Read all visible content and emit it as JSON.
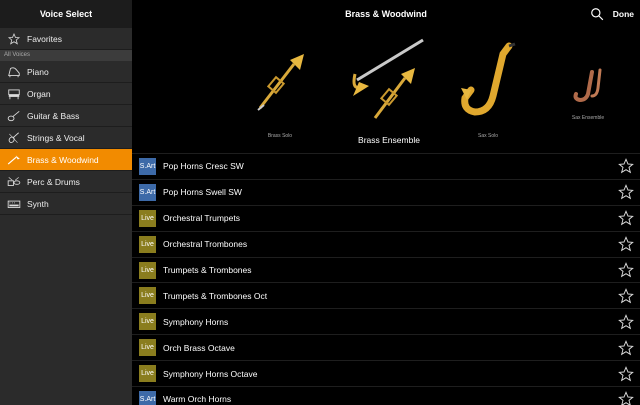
{
  "sidebar": {
    "title": "Voice Select",
    "favorites_label": "Favorites",
    "section_label": "All Voices",
    "items": [
      {
        "label": "Piano",
        "icon": "piano-icon"
      },
      {
        "label": "Organ",
        "icon": "organ-icon"
      },
      {
        "label": "Guitar & Bass",
        "icon": "guitar-icon"
      },
      {
        "label": "Strings & Vocal",
        "icon": "violin-icon"
      },
      {
        "label": "Brass & Woodwind",
        "icon": "trumpet-icon",
        "active": true
      },
      {
        "label": "Perc & Drums",
        "icon": "drums-icon"
      },
      {
        "label": "Synth",
        "icon": "synth-icon"
      }
    ]
  },
  "header": {
    "title": "Brass & Woodwind",
    "done_label": "Done"
  },
  "carousel": {
    "items": [
      {
        "caption": "Brass Solo"
      },
      {
        "caption": "Brass Ensemble"
      },
      {
        "caption": "Sax Solo"
      },
      {
        "caption": "Sax Ensemble"
      }
    ]
  },
  "voices": [
    {
      "badge": "S.Art",
      "name": "Pop Horns Cresc SW"
    },
    {
      "badge": "S.Art",
      "name": "Pop Horns Swell SW"
    },
    {
      "badge": "Live",
      "name": "Orchestral Trumpets"
    },
    {
      "badge": "Live",
      "name": "Orchestral Trombones"
    },
    {
      "badge": "Live",
      "name": "Trumpets & Trombones"
    },
    {
      "badge": "Live",
      "name": "Trumpets & Trombones Oct"
    },
    {
      "badge": "Live",
      "name": "Symphony Horns"
    },
    {
      "badge": "Live",
      "name": "Orch Brass Octave"
    },
    {
      "badge": "Live",
      "name": "Symphony Horns Octave"
    },
    {
      "badge": "S.Art",
      "name": "Warm Orch Horns"
    }
  ],
  "colors": {
    "accent": "#f28b00",
    "sart_badge": "#3d6aa8",
    "live_badge": "#8a7d1e"
  }
}
